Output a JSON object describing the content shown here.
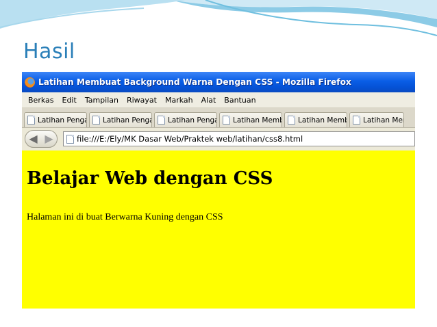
{
  "slide": {
    "title": "Hasil",
    "colors": {
      "title": "#2a7fb8",
      "wave": "#9fd3ea"
    }
  },
  "window": {
    "title": "Latihan Membuat Background Warna Dengan CSS - Mozilla Firefox",
    "icon": "firefox-icon"
  },
  "menubar": {
    "items": [
      "Berkas",
      "Edit",
      "Tampilan",
      "Riwayat",
      "Markah",
      "Alat",
      "Bantuan"
    ]
  },
  "tabs": [
    {
      "label": "Latihan Pengat..."
    },
    {
      "label": "Latihan Pengat..."
    },
    {
      "label": "Latihan Pengat..."
    },
    {
      "label": "Latihan Membu..."
    },
    {
      "label": "Latihan Membu..."
    },
    {
      "label": "Latihan Memb"
    }
  ],
  "navigation": {
    "back_icon": "back-arrow-icon",
    "forward_icon": "forward-arrow-icon",
    "url": "file:///E:/Ely/MK Dasar Web/Praktek web/latihan/css8.html"
  },
  "page": {
    "heading": "Belajar Web dengan CSS",
    "paragraph": "Halaman ini di buat Berwarna Kuning dengan CSS",
    "background_color": "#ffff00"
  }
}
